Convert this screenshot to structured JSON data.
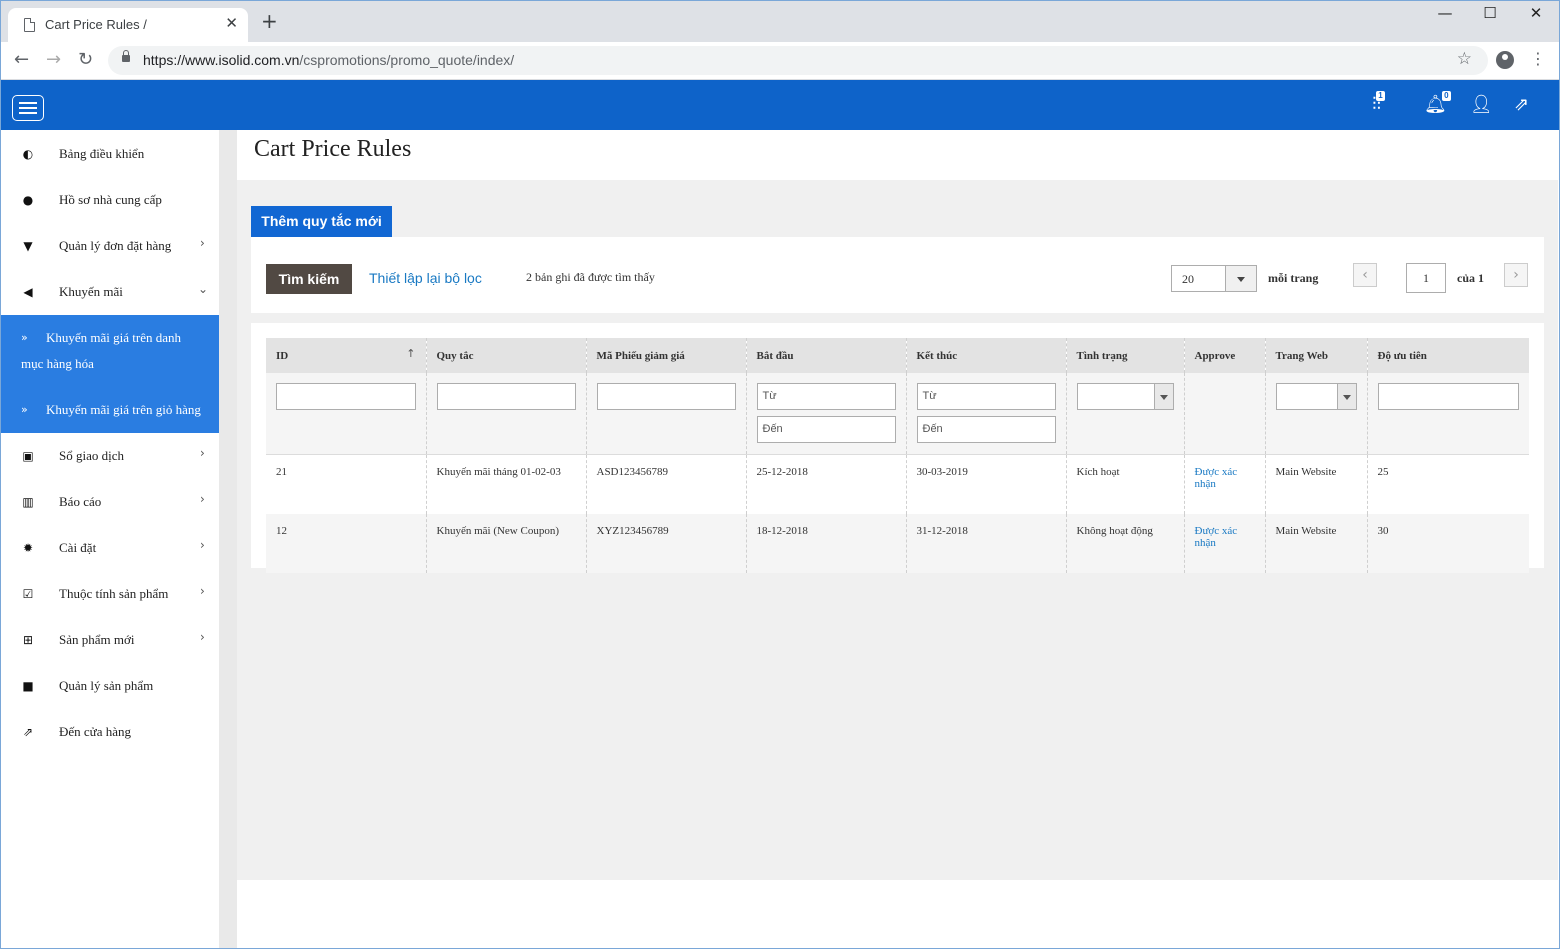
{
  "browser": {
    "tab_title": "Cart Price Rules /",
    "tab_close": "✕",
    "new_tab": "+",
    "url_host": "https://www.isolid.com.vn",
    "url_path": "/cspromotions/promo_quote/index/",
    "window_minimize": "—",
    "window_maximize": "☐",
    "window_close": "✕"
  },
  "header": {
    "notifications_badge_1": "1",
    "notifications_badge_2": "0"
  },
  "sidebar": {
    "items": [
      {
        "label": "Bảng điều khiển",
        "icon": "dashboard-icon"
      },
      {
        "label": "Hồ sơ nhà cung cấp",
        "icon": "user-icon"
      },
      {
        "label": "Quản lý đơn đặt hàng",
        "icon": "cart-icon"
      },
      {
        "label": "Khuyến mãi",
        "icon": "megaphone-icon"
      },
      {
        "label": "Sổ giao dịch",
        "icon": "money-icon"
      },
      {
        "label": "Báo cáo",
        "icon": "bar-chart-icon"
      },
      {
        "label": "Cài đặt",
        "icon": "gear-icon"
      },
      {
        "label": "Thuộc tính sản phẩm",
        "icon": "checkbox-icon"
      },
      {
        "label": "Sản phẩm mới",
        "icon": "plus-square-icon"
      },
      {
        "label": "Quản lý sản phẩm",
        "icon": "folder-icon"
      },
      {
        "label": "Đến cửa hàng",
        "icon": "external-link-icon"
      }
    ],
    "submenu": [
      {
        "label": "Khuyến mãi giá trên danh mục hàng hóa"
      },
      {
        "label": "Khuyến mãi giá trên giỏ hàng"
      }
    ]
  },
  "page": {
    "title": "Cart Price Rules",
    "add_button": "Thêm quy tắc mới",
    "search_button": "Tìm kiếm",
    "reset_filter": "Thiết lập lại bộ lọc",
    "records_found": "2 bản ghi đã được tìm thấy",
    "per_page_value": "20",
    "per_page_label": "mỗi trang",
    "current_page": "1",
    "page_of": "của 1"
  },
  "grid": {
    "columns": [
      "ID",
      "Quy tắc",
      "Mã Phiếu giảm giá",
      "Bắt đầu",
      "Kết thúc",
      "Tình trạng",
      "Approve",
      "Trang Web",
      "Độ ưu tiên"
    ],
    "filter_from": "Từ",
    "filter_to": "Đến",
    "rows": [
      {
        "id": "21",
        "rule": "Khuyến mãi tháng 01-02-03",
        "coupon": "ASD123456789",
        "start": "25-12-2018",
        "end": "30-03-2019",
        "status": "Kích hoạt",
        "approve": "Được xác nhận",
        "website": "Main Website",
        "priority": "25"
      },
      {
        "id": "12",
        "rule": "Khuyến mãi (New Coupon)",
        "coupon": "XYZ123456789",
        "start": "18-12-2018",
        "end": "31-12-2018",
        "status": "Không hoạt động",
        "approve": "Được xác nhận",
        "website": "Main Website",
        "priority": "30"
      }
    ]
  },
  "colors": {
    "header_blue": "#0e63c9",
    "submenu_blue": "#2a7de1",
    "search_button": "#514943",
    "link_blue": "#1979c3"
  }
}
